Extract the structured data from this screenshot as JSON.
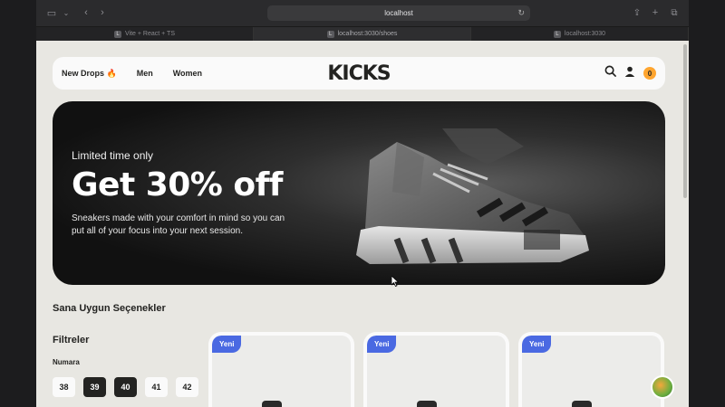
{
  "browser": {
    "url": "localhost",
    "tabs": [
      {
        "label": "Vite + React + TS",
        "favicon": "L"
      },
      {
        "label": "localhost:3030/shoes",
        "favicon": "L"
      },
      {
        "label": "localhost:3030",
        "favicon": "L"
      }
    ]
  },
  "nav": {
    "links": [
      "New Drops 🔥",
      "Men",
      "Women"
    ],
    "logo": "KICKS",
    "cart_count": "0",
    "icons": [
      "search-icon",
      "user-icon"
    ]
  },
  "hero": {
    "subtitle": "Limited time only",
    "title": "Get 30% off",
    "description": "Sneakers made with your comfort in mind so you can put all of your focus into your next session."
  },
  "section": {
    "title": "Sana Uygun Seçenekler",
    "filters_title": "Filtreler",
    "size_title": "Numara",
    "sizes": [
      "38",
      "39",
      "40",
      "41",
      "42"
    ],
    "selected_sizes": [
      "39",
      "40"
    ]
  },
  "cards": [
    {
      "tag": "Yeni"
    },
    {
      "tag": "Yeni"
    },
    {
      "tag": "Yeni"
    }
  ],
  "colors": {
    "accent_blue": "#4a69e2",
    "accent_orange": "#ffa52f",
    "dark": "#232321",
    "background": "#e8e7e2"
  }
}
